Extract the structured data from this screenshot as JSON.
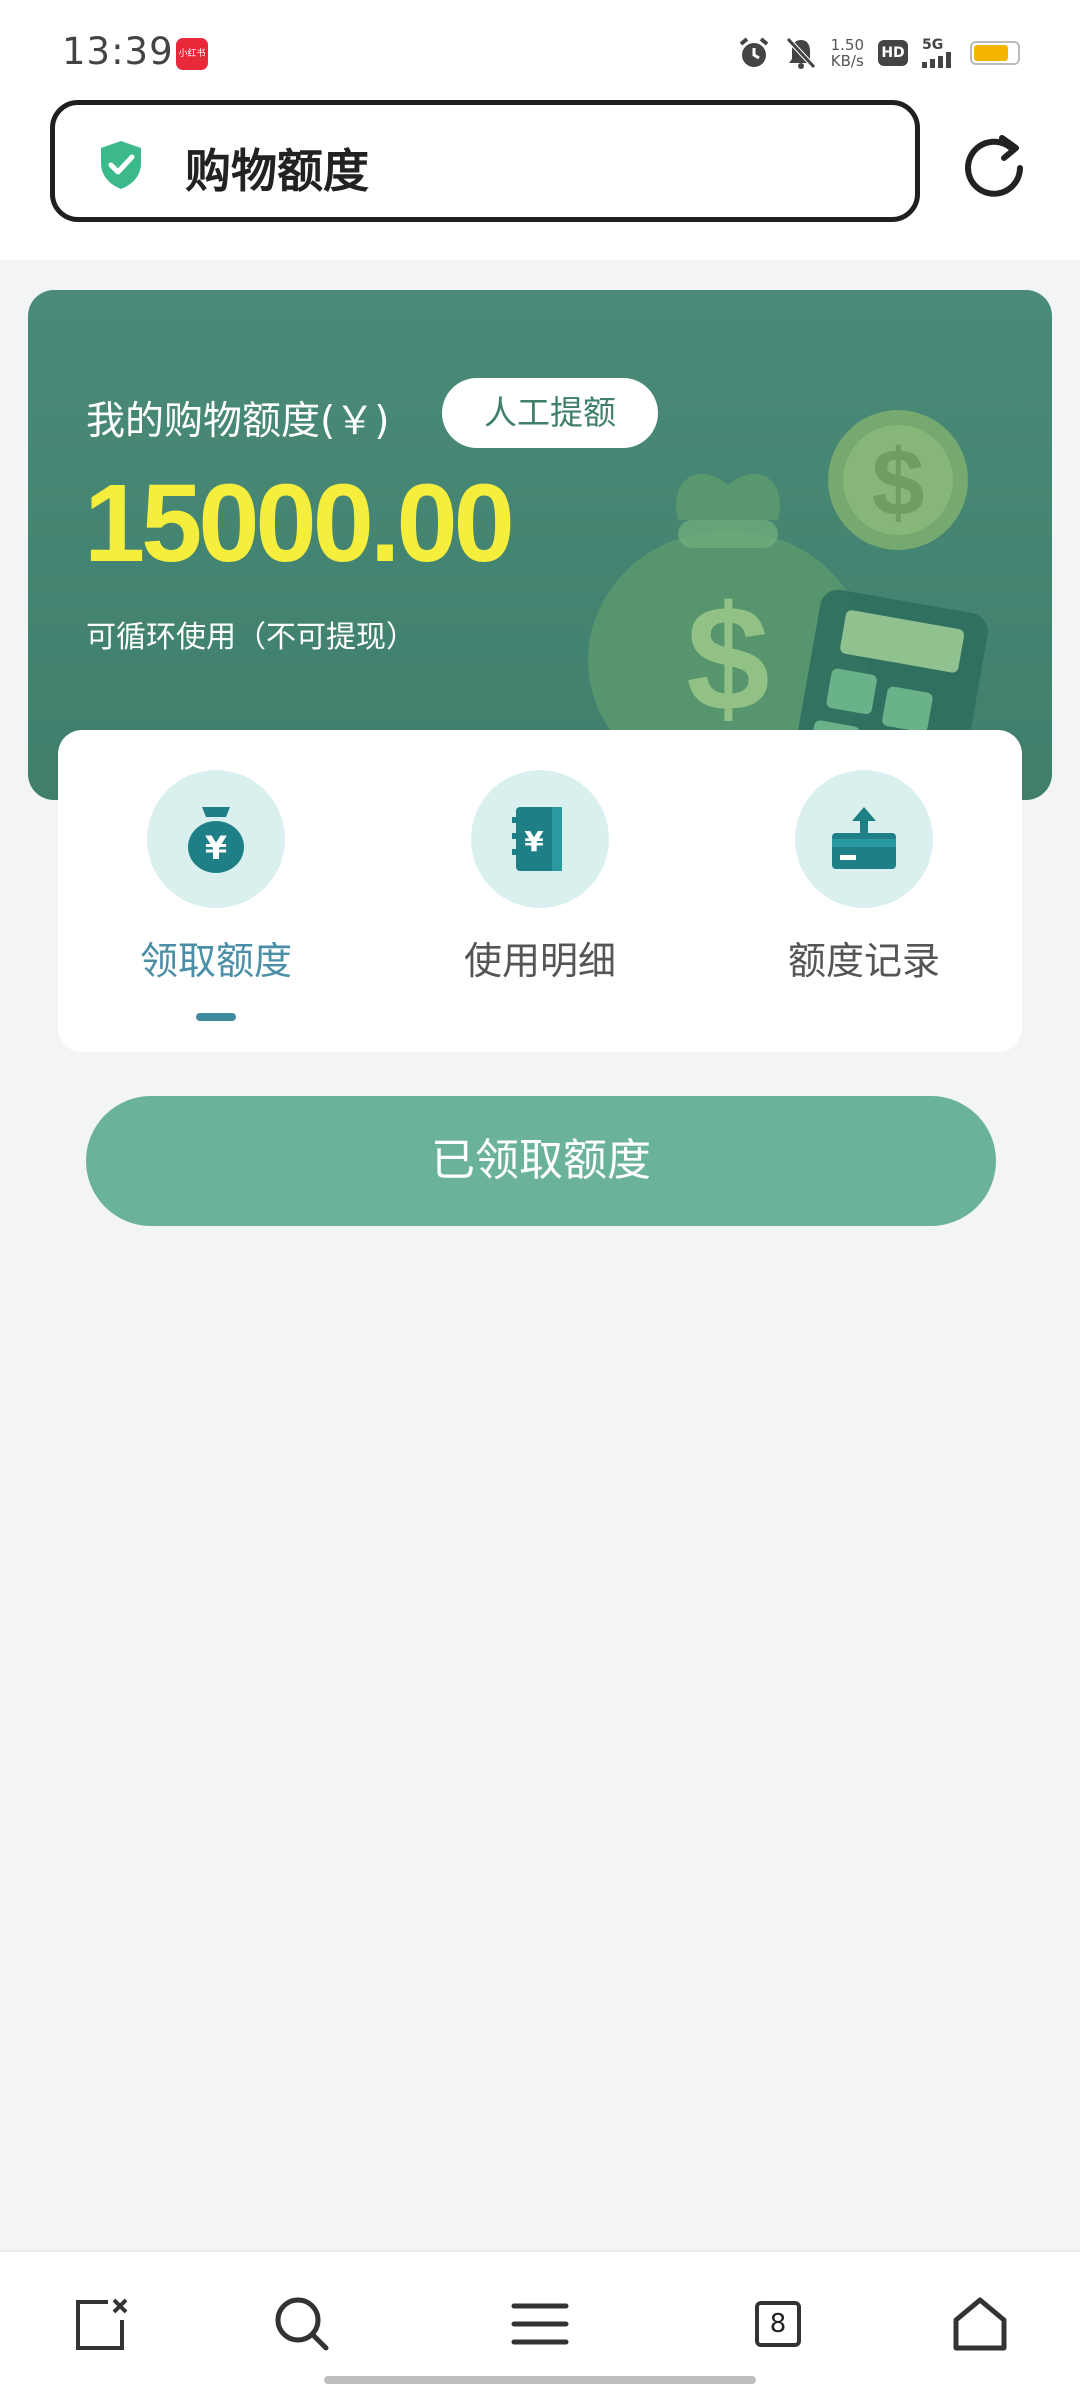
{
  "status_bar": {
    "time": "13:39",
    "app_badge": "小红书",
    "net_speed_value": "1.50",
    "net_speed_unit": "KB/s",
    "hd_label": "HD",
    "network": "5G"
  },
  "address_bar": {
    "title": "购物额度",
    "secure_icon": "shield-check-icon",
    "reload_icon": "reload-icon"
  },
  "quota_card": {
    "label": "我的购物额度(￥)",
    "manual_button": "人工提额",
    "amount": "15000.00",
    "note": "可循环使用（不可提现）"
  },
  "tabs": [
    {
      "label": "领取额度",
      "icon": "money-bag-icon",
      "active": true
    },
    {
      "label": "使用明细",
      "icon": "ledger-icon",
      "active": false
    },
    {
      "label": "额度记录",
      "icon": "card-upload-icon",
      "active": false
    }
  ],
  "main_button": "已领取额度",
  "bottom_nav": {
    "tab_count": "8",
    "icons": [
      "close-tab-icon",
      "search-icon",
      "menu-icon",
      "tabs-icon",
      "home-icon"
    ]
  },
  "colors": {
    "card_green": "#4a8a78",
    "amount_yellow": "#f6ee3c",
    "button_green": "#6ab298",
    "active_tab": "#4a8fa6"
  }
}
